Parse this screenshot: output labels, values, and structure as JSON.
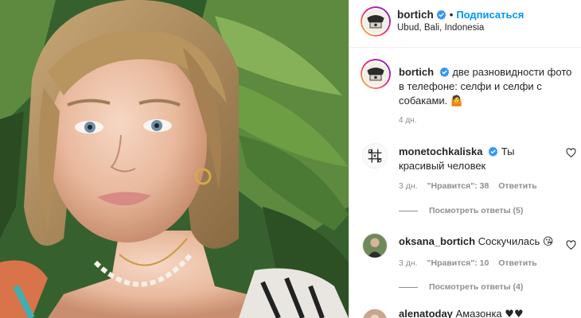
{
  "post": {
    "username": "bortich",
    "follow_label": "Подписаться",
    "dot": "•",
    "location": "Ubud, Bali, Indonesia"
  },
  "caption": {
    "username": "bortich",
    "text": "две разновидности фото в телефоне: селфи и селфи с собаками.",
    "emoji": "🤷",
    "time": "4 дн."
  },
  "comments": [
    {
      "username": "monetochkaliska",
      "verified": true,
      "text": "Ты красивый человек",
      "time": "3 дн.",
      "likes": "\"Нравится\": 38",
      "reply": "Ответить",
      "view_replies": "Посмотреть ответы (5)"
    },
    {
      "username": "oksana_bortich",
      "verified": false,
      "text": "Соскучилась",
      "emoji": "😘",
      "time": "3 дн.",
      "likes": "\"Нравится\": 10",
      "reply": "Ответить",
      "view_replies": "Посмотреть ответы (4)"
    },
    {
      "username": "alenatoday",
      "text": "Амазонка",
      "emoji": "♥♥"
    }
  ],
  "colors": {
    "accent": "#0095f6",
    "verified": "#3897f0",
    "muted": "#8e8e8e",
    "text": "#262626",
    "border": "#efefef"
  },
  "icons": [
    "verified-badge-icon",
    "heart-outline-icon",
    "emoji-shrug-icon",
    "emoji-kiss-icon"
  ]
}
